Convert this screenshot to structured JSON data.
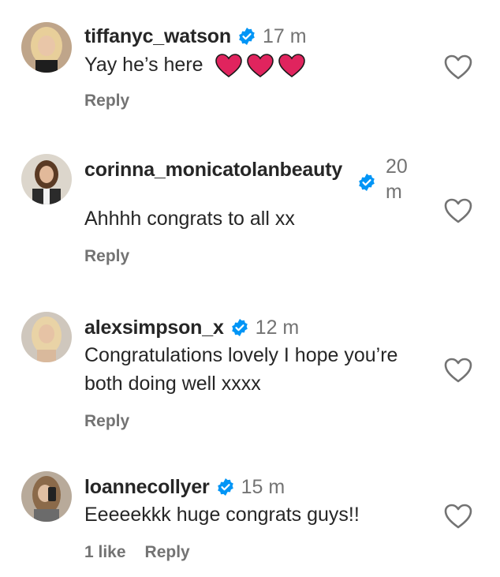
{
  "comments": [
    {
      "username": "tiffanyc_watson",
      "time": "17 m",
      "text": "Yay he’s here",
      "emoji": [
        "red-heart",
        "red-heart",
        "red-heart"
      ],
      "reply_label": "Reply",
      "avatar_icon": "avatar-blonde-woman"
    },
    {
      "username": "corinna_monicatolanbeauty",
      "time": "20 m",
      "text": "Ahhhh congrats to all xx",
      "reply_label": "Reply",
      "avatar_icon": "avatar-brunette-woman"
    },
    {
      "username": "alexsimpson_x",
      "time": "12 m",
      "text": "Congratulations lovely I hope you’re both doing well xxxx",
      "reply_label": "Reply",
      "avatar_icon": "avatar-blonde-woman"
    },
    {
      "username": "loannecollyer",
      "time": "15 m",
      "text": "Eeeeekkk huge congrats guys!!",
      "likes_label": "1 like",
      "reply_label": "Reply",
      "avatar_icon": "avatar-selfie-woman"
    }
  ],
  "colors": {
    "verified_blue": "#0095F6",
    "secondary_text": "#737373",
    "primary_text": "#262626",
    "heart_red": "#E0245E"
  },
  "icons": {
    "verified": "verified-badge-icon",
    "like": "heart-outline-icon"
  }
}
